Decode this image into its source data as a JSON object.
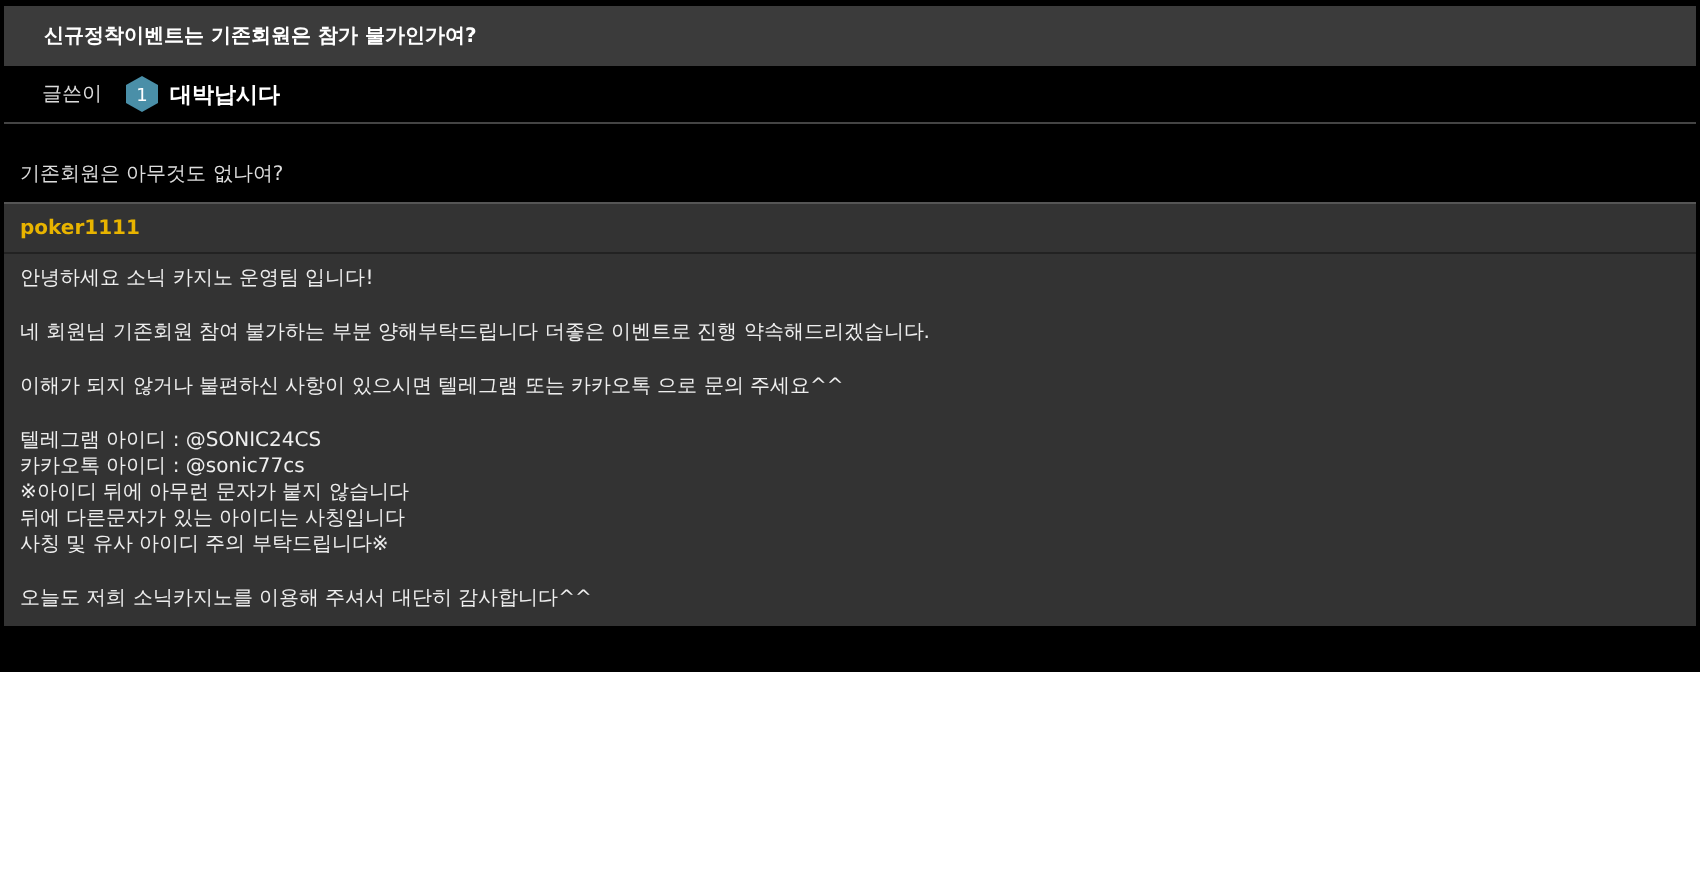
{
  "post": {
    "title": "신규정착이벤트는 기존회원은 참가 불가인가여?",
    "author_label": "글쓴이",
    "author_level": "1",
    "author_name": "대박납시다",
    "body": "기존회원은 아무것도 없나여?"
  },
  "reply": {
    "author": "poker1111",
    "paragraphs": [
      [
        "안녕하세요 소닉 카지노 운영팀 입니다!"
      ],
      [
        "네 회원님 기존회원 참여 불가하는 부분 양해부탁드립니다 더좋은 이벤트로 진행 약속해드리겠습니다."
      ],
      [
        "이해가 되지 않거나 불편하신 사항이 있으시면 텔레그램 또는 카카오톡 으로 문의 주세요^^"
      ],
      [
        "텔레그램 아이디 : @SONIC24CS",
        "카카오톡 아이디 : @sonic77cs",
        "※아이디 뒤에 아무런 문자가 붙지 않습니다",
        "뒤에 다른문자가 있는 아이디는 사칭입니다",
        "사칭 및 유사 아이디 주의 부탁드립니다※"
      ],
      [
        "오늘도 저희 소닉카지노를 이용해 주셔서 대단히 감사합니다^^"
      ]
    ]
  }
}
